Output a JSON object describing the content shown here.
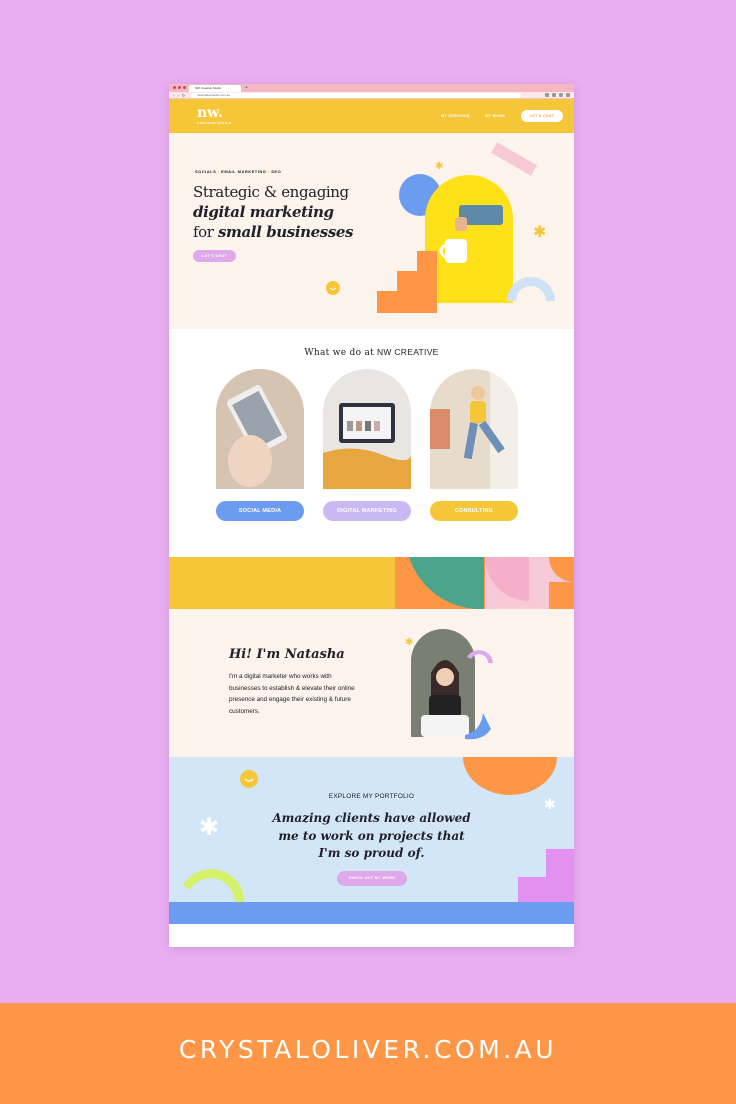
{
  "browser": {
    "tab_title": "NW Creative Studio",
    "new_tab": "+",
    "url": "nwcreativestudio.com.au",
    "back": "‹",
    "forward": "›",
    "reload": "↻"
  },
  "site": {
    "logo": "nw.",
    "logo_sub": "CREATIVE STUDIO",
    "nav": [
      "MY SERVICES",
      "MY WORK"
    ],
    "cta": "LET'S CHAT"
  },
  "hero": {
    "tagline": [
      "SOCIALS",
      "EMAIL MARKETING",
      "SEO"
    ],
    "tagline_sep": "/",
    "line1": "Strategic & engaging",
    "line2": "digital marketing",
    "line3_pre": "for",
    "line3_bold": "small businesses",
    "button": "LET'S CHAT"
  },
  "services": {
    "title": "What we do at",
    "title_brand": "NW CREATIVE",
    "items": [
      {
        "label": "SOCIAL MEDIA",
        "color": "#6b9cf0"
      },
      {
        "label": "DIGITAL MARKETING",
        "color": "#c9b8f2"
      },
      {
        "label": "CONSULTING",
        "color": "#f5c738"
      }
    ]
  },
  "about": {
    "title": "Hi! I'm Natasha",
    "body": "I'm a digital marketer who works with businesses to establish & elevate their online presence and engage their existing & future customers."
  },
  "portfolio": {
    "eyebrow": "EXPLORE MY PORTFOLIO",
    "quote": "Amazing clients have allowed me to work on projects that I'm so proud of.",
    "button": "CHECK OUT MY WORK"
  },
  "banner": {
    "domain": "CRYSTALOLIVER.COM.AU"
  },
  "colors": {
    "page_bg": "#e9aef2",
    "yellow": "#f5c738",
    "orange": "#fd9747",
    "blue": "#6b9cf0",
    "lilac": "#dfa8ea",
    "green": "#4aa58a",
    "cream": "#fbf3ec",
    "sky": "#d3e6f7"
  }
}
